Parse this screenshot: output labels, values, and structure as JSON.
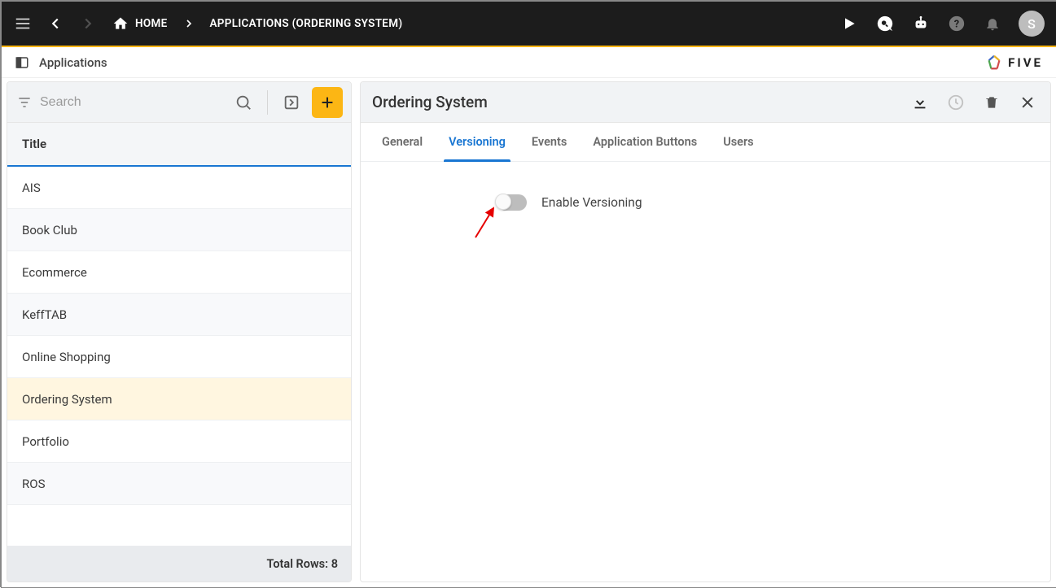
{
  "breadcrumb": {
    "home": "HOME",
    "current": "APPLICATIONS (ORDERING SYSTEM)"
  },
  "avatar_initial": "S",
  "subheader": {
    "title": "Applications",
    "logo_text": "FIVE"
  },
  "search": {
    "placeholder": "Search"
  },
  "list": {
    "column_header": "Title",
    "items": [
      {
        "title": "AIS",
        "selected": false
      },
      {
        "title": "Book Club",
        "selected": false
      },
      {
        "title": "Ecommerce",
        "selected": false
      },
      {
        "title": "KeffTAB",
        "selected": false
      },
      {
        "title": "Online Shopping",
        "selected": false
      },
      {
        "title": "Ordering System",
        "selected": true
      },
      {
        "title": "Portfolio",
        "selected": false
      },
      {
        "title": "ROS",
        "selected": false
      }
    ],
    "footer_label": "Total Rows:",
    "footer_count": "8"
  },
  "detail": {
    "title": "Ordering System",
    "tabs": [
      {
        "label": "General",
        "active": false
      },
      {
        "label": "Versioning",
        "active": true
      },
      {
        "label": "Events",
        "active": false
      },
      {
        "label": "Application Buttons",
        "active": false
      },
      {
        "label": "Users",
        "active": false
      }
    ],
    "versioning": {
      "toggle_label": "Enable Versioning",
      "toggle_value": false
    }
  }
}
